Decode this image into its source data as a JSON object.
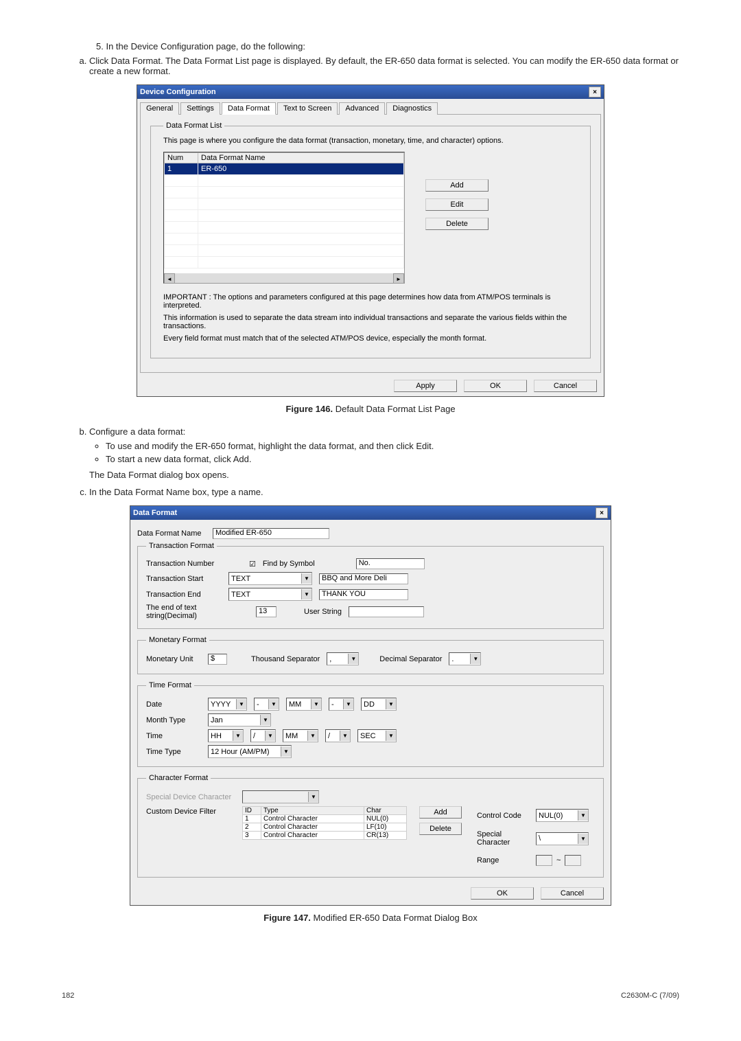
{
  "step5": "5.   In the Device Configuration page, do the following:",
  "step5a": "Click Data Format. The Data Format List page is displayed. By default, the ER-650 data format is selected. You can modify the ER-650 data format or create a new format.",
  "step5b_title": "Configure a data format:",
  "step5b_bullet1": "To use and modify the ER-650 format, highlight the data format, and then click Edit.",
  "step5b_bullet2": "To start a new data format, click Add.",
  "step5b_after": "The Data Format dialog box opens.",
  "step5c": "In the Data Format Name box, type a name.",
  "figure146": {
    "label": "Figure 146.",
    "text": "Default Data Format List Page"
  },
  "figure147": {
    "label": "Figure 147.",
    "text": "Modified ER-650 Data Format Dialog Box"
  },
  "dlg1": {
    "title": "Device Configuration",
    "tabs": [
      "General",
      "Settings",
      "Data Format",
      "Text to Screen",
      "Advanced",
      "Diagnostics"
    ],
    "group": "Data Format List",
    "explain": "This page is where you configure the data format (transaction, monetary, time, and character) options.",
    "cols": [
      "Num",
      "Data Format Name"
    ],
    "row": {
      "num": "1",
      "name": "ER-650"
    },
    "add": "Add",
    "edit": "Edit",
    "delete": "Delete",
    "note1": "IMPORTANT : The options and parameters configured at this page determines how data from ATM/POS terminals is interpreted.",
    "note2": "This information is used to separate the data stream into individual transactions and separate the various fields within the transactions.",
    "note3": "Every field format must match that of the selected ATM/POS device, especially the month format.",
    "apply": "Apply",
    "ok": "OK",
    "cancel": "Cancel"
  },
  "dlg2": {
    "title": "Data Format",
    "name_label": "Data Format Name",
    "name_value": "Modified ER-650",
    "tf_group": "Transaction Format",
    "tf_number": "Transaction Number",
    "tf_find": "Find by Symbol",
    "tf_no": "No.",
    "tf_start": "Transaction Start",
    "tf_start_sel": "TEXT",
    "tf_start_val": "BBQ and More Deli",
    "tf_end": "Transaction End",
    "tf_end_sel": "TEXT",
    "tf_end_val": "THANK YOU",
    "tf_eot": "The end of text string(Decimal)",
    "tf_eot_val": "13",
    "tf_userstring": "User String",
    "mf_group": "Monetary Format",
    "mf_unit": "Monetary Unit",
    "mf_unit_val": "$",
    "mf_thousand": "Thousand Separator",
    "mf_thousand_val": ",",
    "mf_decimal": "Decimal Separator",
    "mf_decimal_val": ".",
    "tm_group": "Time Format",
    "tm_date": "Date",
    "tm_date_y": "YYYY",
    "tm_sep1": "-",
    "tm_date_m": "MM",
    "tm_sep2": "-",
    "tm_date_d": "DD",
    "tm_month": "Month Type",
    "tm_month_val": "Jan",
    "tm_time": "Time",
    "tm_time_h": "HH",
    "tm_time_s1": "/",
    "tm_time_m": "MM",
    "tm_time_s2": "/",
    "tm_time_s": "SEC",
    "tm_type": "Time Type",
    "tm_type_val": "12 Hour (AM/PM)",
    "cf_group": "Character Format",
    "cf_special": "Special Device Character",
    "cf_custom": "Custom Device Filter",
    "cf_cols": [
      "ID",
      "Type",
      "Char"
    ],
    "cf_rows": [
      {
        "id": "1",
        "type": "Control Character",
        "ch": "NUL(0)"
      },
      {
        "id": "2",
        "type": "Control Character",
        "ch": "LF(10)"
      },
      {
        "id": "3",
        "type": "Control Character",
        "ch": "CR(13)"
      }
    ],
    "cf_add": "Add",
    "cf_delete": "Delete",
    "cf_controlcode": "Control Code",
    "cf_controlcode_val": "NUL(0)",
    "cf_specialchar": "Special Character",
    "cf_specialchar_val": "\\",
    "cf_range": "Range",
    "cf_range_sep": "~",
    "ok": "OK",
    "cancel": "Cancel"
  },
  "page_num": "182",
  "doc_code": "C2630M-C (7/09)"
}
